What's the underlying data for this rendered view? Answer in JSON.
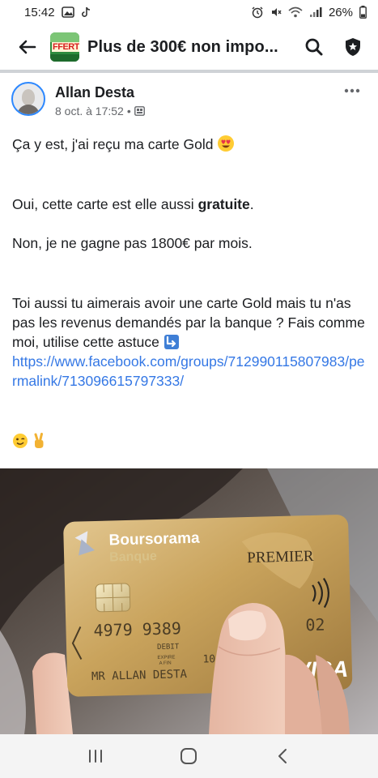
{
  "status_bar": {
    "time": "15:42",
    "battery": "26%",
    "left_icons": [
      "gallery-icon",
      "tiktok-icon"
    ],
    "right_icons": [
      "alarm-icon",
      "mute-icon",
      "wifi-icon",
      "signal-icon",
      "battery-icon"
    ]
  },
  "app_bar": {
    "title": "Plus de 300€ non impo...",
    "group_thumb_text": "FFERT",
    "back_icon": "arrow-left-icon",
    "search_icon": "search-icon",
    "badge_icon": "shield-star-icon"
  },
  "post": {
    "author": "Allan Desta",
    "date": "8 oct. à 17:52",
    "separator": "•",
    "audience_icon": "group-photo-icon",
    "line1": "Ça y est, j'ai reçu ma carte Gold",
    "line2_before": "Oui, cette carte est elle aussi ",
    "line2_bold": "gratuite",
    "line2_after": ".",
    "line3": "Non, je ne gagne pas 1800€ par mois.",
    "line4": "Toi aussi tu aimerais avoir une carte Gold mais tu n'as pas les revenus demandés par la banque ? Fais comme moi, utilise cette astuce",
    "link": "https://www.facebook.com/groups/712990115807983/permalink/713096615797333/",
    "emoji_line1": "heart-eyes-emoji",
    "emoji_line4": "arrow-down-right-emoji",
    "emoji_end": [
      "wink-emoji",
      "victory-hand-emoji"
    ]
  },
  "card_photo": {
    "bank_name": "Boursorama",
    "bank_sub": "Banque",
    "tier": "PREMIER",
    "number_visible": "4979 9389",
    "number_end": "02",
    "debit": "DEBIT",
    "expire_label_1": "EXPIRE",
    "expire_label_2": "A FIN",
    "expire_partial": "10",
    "holder": "MR ALLAN DESTA",
    "network": "VISA"
  },
  "nav_bar": {
    "icons": [
      "recent-apps-icon",
      "home-icon",
      "back-icon"
    ]
  },
  "colors": {
    "link": "#3578e5",
    "text": "#1c1e21",
    "meta": "#65676b",
    "card_gold": "#c9a35c"
  }
}
